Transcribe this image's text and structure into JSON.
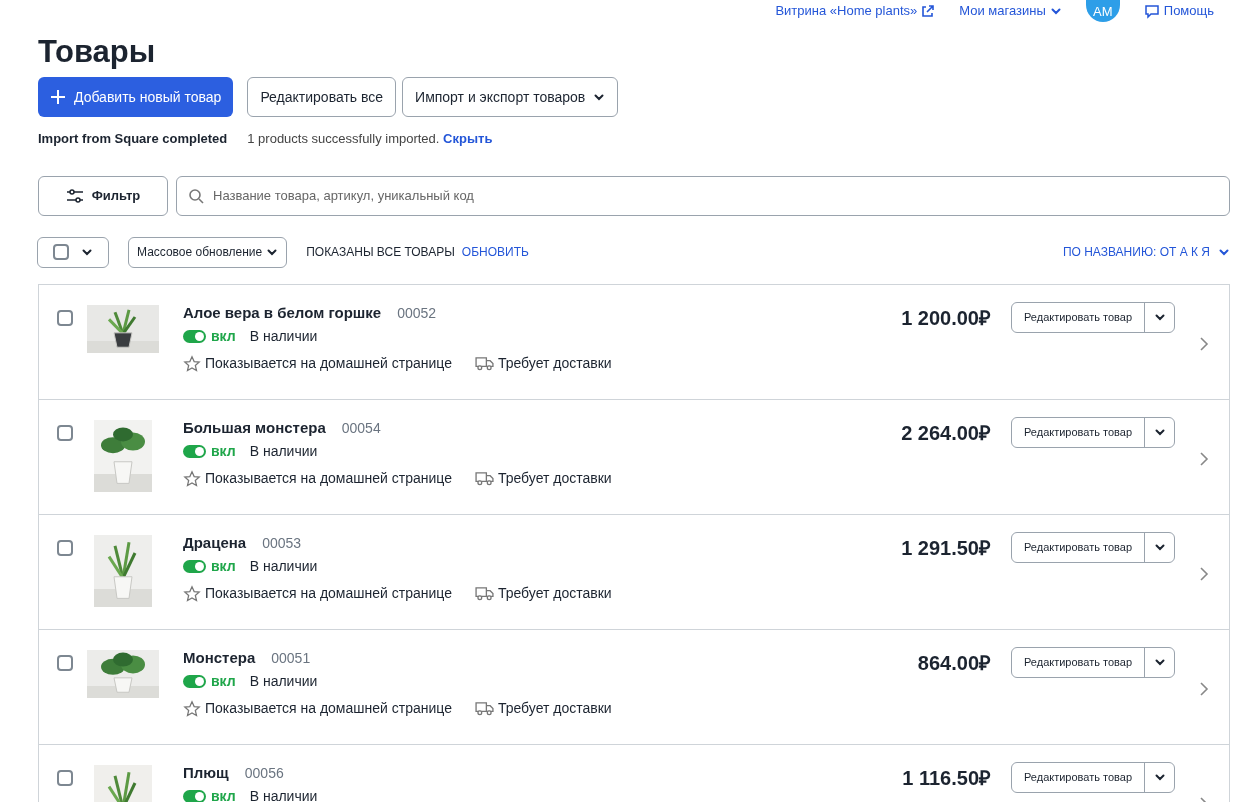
{
  "top_nav": {
    "storefront": "Витрина «Home plants»",
    "stores": "Мои магазины",
    "avatar": "AM",
    "help": "Помощь"
  },
  "title": "Товары",
  "actions": {
    "add": "Добавить новый товар",
    "edit_all": "Редактировать все",
    "import_export": "Импорт и экспорт товаров"
  },
  "notice": {
    "title": "Import from Square completed",
    "message": "1 products successfully imported.",
    "link": "Скрыть"
  },
  "filter": {
    "button": "Фильтр",
    "search_placeholder": "Название товара, артикул, уникальный код"
  },
  "toolbar": {
    "select_all_checked": false,
    "bulk": "Массовое обновление",
    "status": "ПОКАЗАНЫ ВСЕ ТОВАРЫ",
    "refresh": "ОБНОВИТЬ",
    "sort": "ПО НАЗВАНИЮ: ОТ А К Я"
  },
  "products": [
    {
      "name": "Алое вера в белом горшке",
      "code": "00052",
      "checked": false,
      "on": true,
      "toggle_label": "вкл",
      "stock": "В наличии",
      "featured": "Показывается на домашней странице",
      "shipping": "Требует доставки",
      "price": "1 200.00₽",
      "edit": "Редактировать товар"
    },
    {
      "name": "Большая монстера",
      "code": "00054",
      "checked": false,
      "on": true,
      "toggle_label": "вкл",
      "stock": "В наличии",
      "featured": "Показывается на домашней странице",
      "shipping": "Требует доставки",
      "price": "2 264.00₽",
      "edit": "Редактировать товар"
    },
    {
      "name": "Драцена",
      "code": "00053",
      "checked": false,
      "on": true,
      "toggle_label": "вкл",
      "stock": "В наличии",
      "featured": "Показывается на домашней странице",
      "shipping": "Требует доставки",
      "price": "1 291.50₽",
      "edit": "Редактировать товар"
    },
    {
      "name": "Монстера",
      "code": "00051",
      "checked": false,
      "on": true,
      "toggle_label": "вкл",
      "stock": "В наличии",
      "featured": "Показывается на домашней странице",
      "shipping": "Требует доставки",
      "price": "864.00₽",
      "edit": "Редактировать товар"
    },
    {
      "name": "Плющ",
      "code": "00056",
      "checked": false,
      "on": true,
      "toggle_label": "вкл",
      "stock": "В наличии",
      "price": "1 116.50₽",
      "edit": "Редактировать товар"
    }
  ]
}
